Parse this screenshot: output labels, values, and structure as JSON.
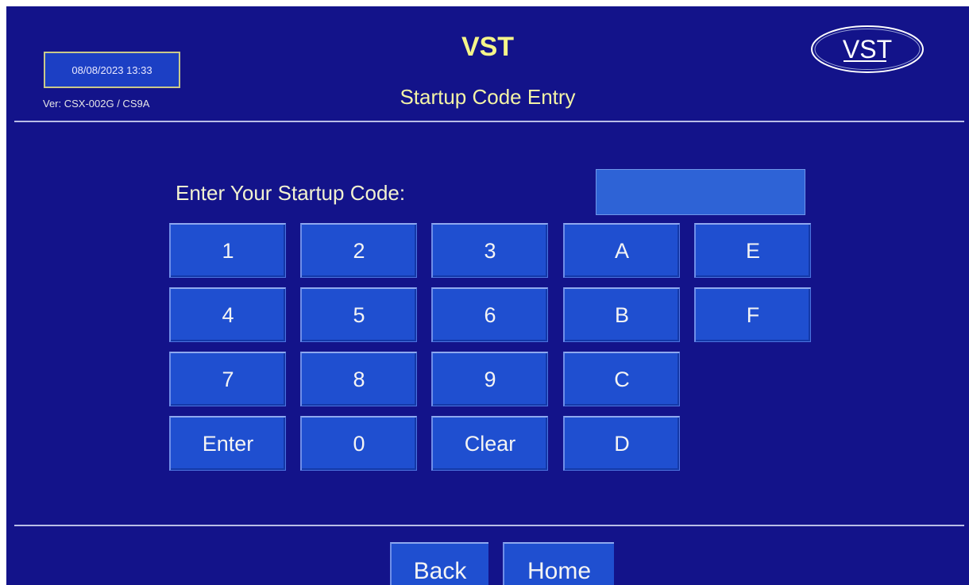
{
  "header": {
    "datetime": "08/08/2023 13:33",
    "version": "Ver: CSX-002G / CS9A",
    "app_title": "VST",
    "page_title": "Startup Code Entry",
    "logo_text": "VST"
  },
  "form": {
    "prompt": "Enter Your Startup Code:",
    "code_value": ""
  },
  "keypad": {
    "k1": "1",
    "k2": "2",
    "k3": "3",
    "kA": "A",
    "kE": "E",
    "k4": "4",
    "k5": "5",
    "k6": "6",
    "kB": "B",
    "kF": "F",
    "k7": "7",
    "k8": "8",
    "k9": "9",
    "kC": "C",
    "enter": "Enter",
    "k0": "0",
    "clear": "Clear",
    "kD": "D"
  },
  "footer": {
    "back_label": "Back",
    "home_label": "Home"
  },
  "colors": {
    "background": "#13138a",
    "title": "#f5f58a",
    "key": "#1f4fd0",
    "input": "#2e63d6"
  }
}
